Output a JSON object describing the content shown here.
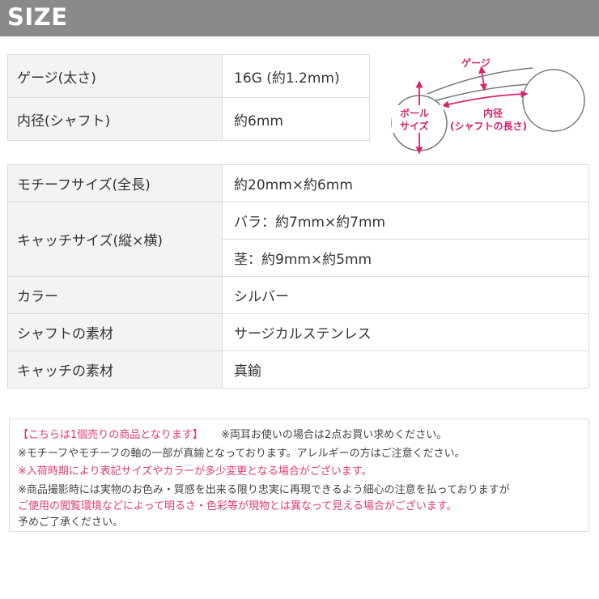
{
  "header": {
    "title": "SIZE"
  },
  "spec_top": [
    {
      "label": "ゲージ(太さ)",
      "value": "16G (約1.2mm)"
    },
    {
      "label": "内径(シャフト)",
      "value": "約6mm"
    }
  ],
  "diagram": {
    "gauge_label": "ゲージ",
    "ball_label_1": "ボール",
    "ball_label_2": "サイズ",
    "inner_label_1": "内径",
    "inner_label_2": "(シャフトの長さ)",
    "accent_color": "#d6246e"
  },
  "spec_main": {
    "motif_label": "モチーフサイズ(全長)",
    "motif_value": "約20mm×約6mm",
    "catch_label": "キャッチサイズ(縦×横)",
    "catch_value_1": "バラ：約7mm×約7mm",
    "catch_value_2": "茎：約9mm×約5mm",
    "color_label": "カラー",
    "color_value": "シルバー",
    "shaft_label": "シャフトの素材",
    "shaft_value": "サージカルステンレス",
    "catch_mat_label": "キャッチの素材",
    "catch_mat_value": "真鍮"
  },
  "notes": {
    "line1_pink": "【こちらは1個売りの商品となります】",
    "line1_gray": "※両耳お使いの場合は2点お買い求めください。",
    "line2": "※モチーフやモチーフの軸の一部が真鍮となっております。アレルギーの方はご注意ください。",
    "line3": "※入荷時期により表記サイズやカラーが多少変更となる場合がございます。",
    "line4": "※商品撮影時には実物のお色み・質感を出来る限り忠実に再現できるよう細心の注意を払っておりますが",
    "line5": "ご使用の閲覧環境などによって明るさ・色彩等が現物とは異なって見える場合がございます。",
    "line6": "予めご了承ください。"
  }
}
